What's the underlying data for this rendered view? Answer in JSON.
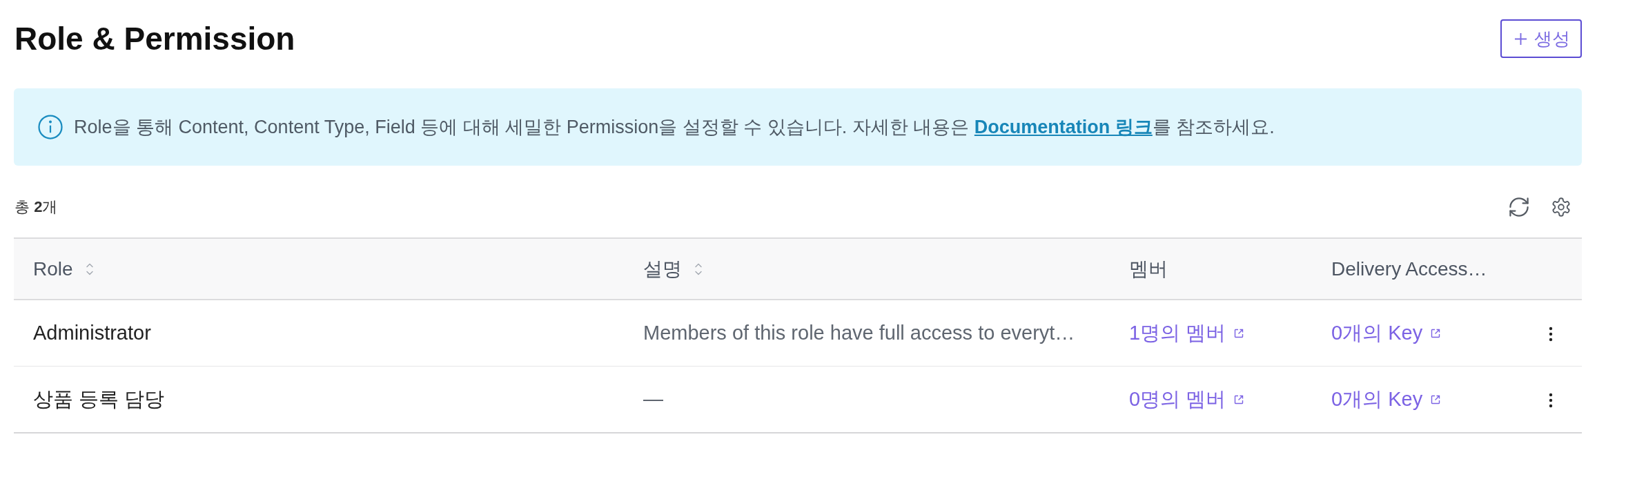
{
  "page": {
    "title": "Role & Permission"
  },
  "create_button": {
    "label": "생성"
  },
  "notice": {
    "text_before": "Role을 통해 Content, Content Type, Field 등에 대해 세밀한 Permission을 설정할 수 있습니다. 자세한 내용은 ",
    "link": "Documentation 링크",
    "text_after": "를 참조하세요."
  },
  "summary": {
    "total": "총 **2**개"
  },
  "table": {
    "columns": [
      {
        "label": "Role",
        "sortable": true
      },
      {
        "label": "설명",
        "sortable": true
      },
      {
        "label": "멤버",
        "sortable": false
      },
      {
        "label": "Delivery Access…",
        "sortable": false
      }
    ],
    "rows": [
      {
        "role": "Administrator",
        "description": "Members of this role have full access to everyt…",
        "members": "1명의 멤버",
        "keys": "0개의 Key"
      },
      {
        "role": "상품 등록 담당",
        "description": "—",
        "members": "0명의 멤버",
        "keys": "0개의 Key"
      }
    ]
  }
}
